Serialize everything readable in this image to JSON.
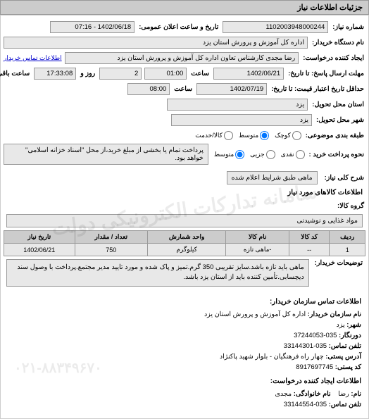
{
  "header": "جزئیات اطلاعات نیاز",
  "watermark1": "سامانه تدارکات الکترونیکی دولت",
  "watermark2": "۰۲۱-۸۸۳۴۹۶۷۰",
  "fields": {
    "request_no_label": "شماره نیاز:",
    "request_no": "1102003948000244",
    "announce_label": "تاریخ و ساعت اعلان عمومی:",
    "announce": "1402/06/18 - 07:16",
    "buyer_org_label": "نام دستگاه خریدار:",
    "buyer_org": "اداره کل آموزش و پرورش استان یزد",
    "requester_label": "ایجاد کننده درخواست:",
    "requester": "رضا مجدی کارشناس تعاون اداره کل آموزش و پرورش استان یزد",
    "buyer_contact_link": "اطلاعات تماس خریدار",
    "deadline_label": "مهلت ارسال پاسخ: تا تاریخ:",
    "deadline_date": "1402/06/21",
    "deadline_time_label": "ساعت",
    "deadline_time": "01:00",
    "days_label": "روز و",
    "days": "2",
    "remain_time": "17:33:08",
    "remain_label": "ساعت باقی مانده",
    "until_label": "حداقل تاریخ اعتبار قیمت: تا تاریخ:",
    "until_date": "1402/07/19",
    "until_time_label": "ساعت",
    "until_time": "08:00",
    "province_label": "استان محل تحویل:",
    "province": "یزد",
    "city_label": "شهر محل تحویل:",
    "city": "یزد",
    "category_label": "طبقه بندی موضوعی:",
    "cat_opt1": "کوچک",
    "cat_opt2": "متوسط",
    "cat_opt3": "کالا/خدمت",
    "payment_label": "نحوه پرداخت خرید :",
    "pay_opt1": "نقدی",
    "pay_opt2": "جزیی",
    "pay_opt3": "متوسط",
    "pay_note": "پرداخت تمام یا بخشی از مبلغ خرید،از محل \"اسناد خزانه اسلامی\" خواهد بود.",
    "subject_label": "شرح کلی نیاز:",
    "subject": "ماهی طبق شرایط اعلام شده",
    "items_header": "اطلاعات کالاهای مورد نیاز",
    "group_label": "گروه کالا:",
    "group": "مواد غذایی و نوشیدنی"
  },
  "table": {
    "headers": [
      "ردیف",
      "کد کالا",
      "نام کالا",
      "واحد شمارش",
      "تعداد / مقدار",
      "تاریخ نیاز"
    ],
    "rows": [
      [
        "1",
        "--",
        "-ماهی تازه",
        "کیلوگرم",
        "750",
        "1402/06/21"
      ]
    ]
  },
  "buyer_note": {
    "label": "توضیحات خریدار:",
    "text": "ماهی باید تازه باشد.سایز تقریبی 350 گرم.تمیز و پاک شده و مورد تایید مدیر مجتمع.پرداخت با وصول سند دیچسابی.تأمین کننده باید از استان یزد باشد."
  },
  "contact": {
    "header": "اطلاعات تماس سازمان خریدار:",
    "org_label": "نام سازمان خریدار:",
    "org": "اداره کل آموزش و پرورش استان یزد",
    "city_label": "شهر:",
    "city": "یزد",
    "fax_label": "دورنگار:",
    "fax": "035-37244053",
    "tel_label": "تلفن تماس:",
    "tel": "035-33144301",
    "addr_label": "آدرس پستی:",
    "addr": "چهار راه فرهنگیان - بلوار شهید پاکنژاد",
    "postal_label": "کد پستی:",
    "postal": "8917697745",
    "req_header": "اطلاعات ایجاد کننده درخواست:",
    "name_label": "نام:",
    "name": "رضا",
    "family_label": "نام خانوادگی:",
    "family": "مجدی",
    "tel2_label": "تلفن تماس:",
    "tel2": "035-33144554"
  }
}
